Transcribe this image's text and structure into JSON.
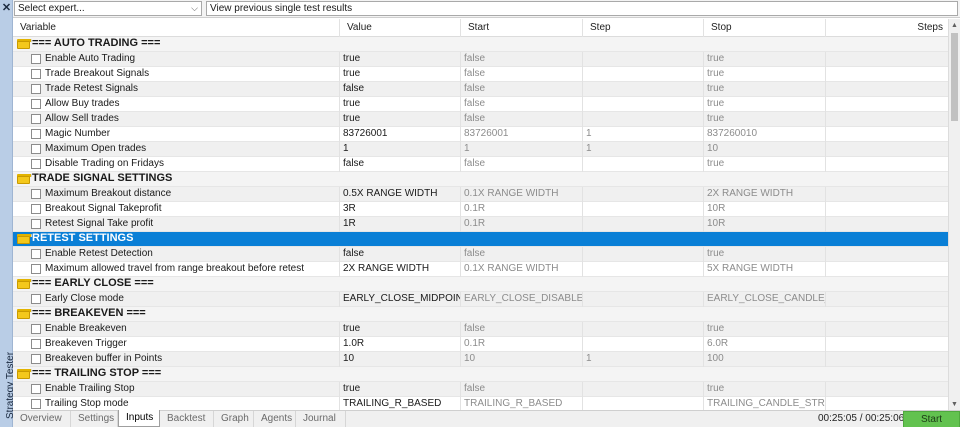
{
  "side": {
    "close": "✕",
    "label": "Strategy Tester"
  },
  "top": {
    "expert": "Select expert...",
    "view": "View previous single test results"
  },
  "headers": {
    "variable": "Variable",
    "value": "Value",
    "start": "Start",
    "step": "Step",
    "stop": "Stop",
    "steps": "Steps"
  },
  "rows": [
    {
      "type": "group",
      "label": "=== AUTO TRADING ==="
    },
    {
      "type": "param",
      "label": "Enable Auto Trading",
      "value": "true",
      "start": "false",
      "step": "",
      "stop": "true"
    },
    {
      "type": "param",
      "label": "Trade Breakout Signals",
      "value": "true",
      "start": "false",
      "step": "",
      "stop": "true"
    },
    {
      "type": "param",
      "label": "Trade Retest Signals",
      "value": "false",
      "start": "false",
      "step": "",
      "stop": "true"
    },
    {
      "type": "param",
      "label": "Allow Buy trades",
      "value": "true",
      "start": "false",
      "step": "",
      "stop": "true"
    },
    {
      "type": "param",
      "label": "Allow Sell trades",
      "value": "true",
      "start": "false",
      "step": "",
      "stop": "true"
    },
    {
      "type": "param",
      "label": "Magic Number",
      "value": "83726001",
      "start": "83726001",
      "step": "1",
      "stop": "837260010"
    },
    {
      "type": "param",
      "label": "Maximum Open trades",
      "value": "1",
      "start": "1",
      "step": "1",
      "stop": "10"
    },
    {
      "type": "param",
      "label": "Disable Trading on Fridays",
      "value": "false",
      "start": "false",
      "step": "",
      "stop": "true"
    },
    {
      "type": "group",
      "label": "TRADE SIGNAL SETTINGS"
    },
    {
      "type": "param",
      "label": "Maximum Breakout distance",
      "value": "0.5X RANGE WIDTH",
      "start": "0.1X RANGE WIDTH",
      "step": "",
      "stop": "2X RANGE WIDTH"
    },
    {
      "type": "param",
      "label": "Breakout Signal Takeprofit",
      "value": "3R",
      "start": "0.1R",
      "step": "",
      "stop": "10R"
    },
    {
      "type": "param",
      "label": "Retest Signal Take profit",
      "value": "1R",
      "start": "0.1R",
      "step": "",
      "stop": "10R"
    },
    {
      "type": "group",
      "label": "RETEST SETTINGS",
      "selected": true
    },
    {
      "type": "param",
      "label": "Enable Retest Detection",
      "value": "false",
      "start": "false",
      "step": "",
      "stop": "true"
    },
    {
      "type": "param",
      "label": "Maximum allowed travel from range breakout before retest",
      "value": "2X RANGE WIDTH",
      "start": "0.1X RANGE WIDTH",
      "step": "",
      "stop": "5X RANGE WIDTH"
    },
    {
      "type": "group",
      "label": "=== EARLY CLOSE ==="
    },
    {
      "type": "param",
      "label": "Early Close mode",
      "value": "EARLY_CLOSE_MIDPOINT_...",
      "start": "EARLY_CLOSE_DISABLED",
      "step": "",
      "stop": "EARLY_CLOSE_CANDLE_BA..."
    },
    {
      "type": "group",
      "label": "=== BREAKEVEN ==="
    },
    {
      "type": "param",
      "label": "Enable Breakeven",
      "value": "true",
      "start": "false",
      "step": "",
      "stop": "true"
    },
    {
      "type": "param",
      "label": "Breakeven Trigger",
      "value": "1.0R",
      "start": "0.1R",
      "step": "",
      "stop": "6.0R"
    },
    {
      "type": "param",
      "label": "Breakeven buffer in Points",
      "value": "10",
      "start": "10",
      "step": "1",
      "stop": "100"
    },
    {
      "type": "group",
      "label": "=== TRAILING STOP ==="
    },
    {
      "type": "param",
      "label": "Enable Trailing Stop",
      "value": "true",
      "start": "false",
      "step": "",
      "stop": "true"
    },
    {
      "type": "param",
      "label": "Trailing Stop mode",
      "value": "TRAILING_R_BASED",
      "start": "TRAILING_R_BASED",
      "step": "",
      "stop": "TRAILING_CANDLE_STRUCT..."
    }
  ],
  "tabs": [
    "Overview",
    "Settings",
    "Inputs",
    "Backtest",
    "Graph",
    "Agents",
    "Journal"
  ],
  "active_tab": "Inputs",
  "timer": "00:25:05 / 00:25:06",
  "start_label": "Start",
  "colors": {
    "selected_row": "#0a7fd6",
    "start_button": "#62c24f",
    "folder": "#f4c81b"
  }
}
